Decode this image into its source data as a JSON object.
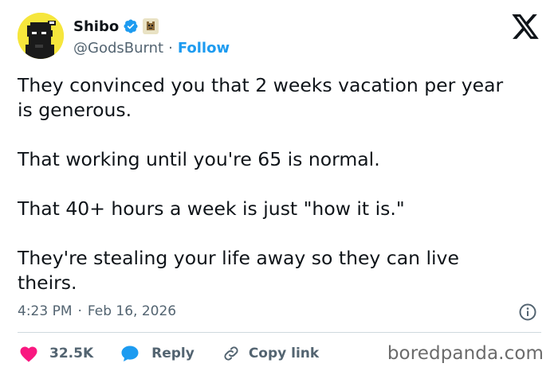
{
  "author": {
    "display_name": "Shibo",
    "handle": "@GodsBurnt",
    "follow_label": "Follow",
    "separator": "·"
  },
  "tweet": {
    "paragraphs": [
      "They convinced you that 2 weeks vacation per year is generous.",
      "That working until you're 65 is normal.",
      "That 40+ hours a week is just \"how it is.\"",
      "They're stealing your life away so they can live theirs."
    ],
    "time": "4:23 PM",
    "date": "Feb 16, 2026",
    "separator": "·"
  },
  "actions": {
    "like_count": "32.5K",
    "reply_label": "Reply",
    "copy_link_label": "Copy link"
  },
  "watermark": "boredpanda.com",
  "colors": {
    "accent": "#1d9bf0",
    "like": "#f91880",
    "text": "#0f1419",
    "muted": "#536471",
    "avatar_bg": "#f6e63c"
  },
  "icons": {
    "verified": "verified-badge-icon",
    "x_logo": "x-logo-icon",
    "info": "info-icon",
    "like": "heart-icon",
    "reply": "speech-bubble-icon",
    "copy": "link-icon"
  }
}
